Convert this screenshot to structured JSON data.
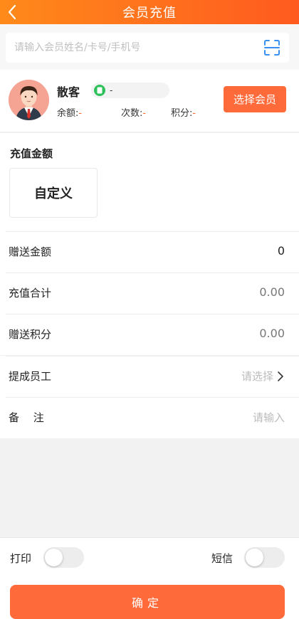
{
  "header": {
    "title": "会员充值"
  },
  "search": {
    "placeholder": "请输入会员姓名/卡号/手机号"
  },
  "member": {
    "name": "散客",
    "phone": "-",
    "balance_label": "余额:",
    "balance_value": "-",
    "count_label": "次数:",
    "count_value": "-",
    "points_label": "积分:",
    "points_value": "-",
    "select_button": "选择会员"
  },
  "amount": {
    "label": "充值金额",
    "custom_option": "自定义"
  },
  "rows": [
    {
      "label": "赠送金额",
      "value": "0"
    },
    {
      "label": "充值合计",
      "value": "0.00"
    },
    {
      "label": "赠送积分",
      "value": "0.00"
    },
    {
      "label": "提成员工",
      "value": "请选择"
    },
    {
      "label": "备　 注",
      "value": "请输入"
    }
  ],
  "toggles": {
    "print_label": "打印",
    "print_on": false,
    "sms_label": "短信",
    "sms_on": false
  },
  "footer": {
    "confirm_label": "确定"
  },
  "colors": {
    "accent": "#ff6a3a",
    "header_start": "#ff8a1a",
    "header_end": "#ff5a1f",
    "wechat_green": "#2ec05a"
  }
}
